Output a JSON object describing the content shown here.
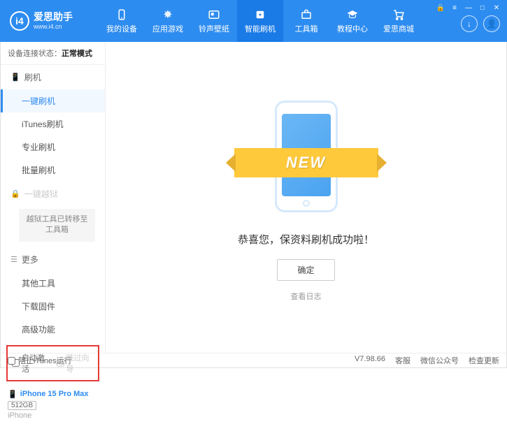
{
  "header": {
    "appName": "爱思助手",
    "appUrl": "www.i4.cn",
    "nav": [
      {
        "label": "我的设备"
      },
      {
        "label": "应用游戏"
      },
      {
        "label": "铃声壁纸"
      },
      {
        "label": "智能刷机"
      },
      {
        "label": "工具箱"
      },
      {
        "label": "教程中心"
      },
      {
        "label": "爱思商城"
      }
    ]
  },
  "sidebar": {
    "connLabel": "设备连接状态：",
    "connStatus": "正常模式",
    "secFlash": "刷机",
    "items1": [
      {
        "label": "一键刷机"
      },
      {
        "label": "iTunes刷机"
      },
      {
        "label": "专业刷机"
      },
      {
        "label": "批量刷机"
      }
    ],
    "secJailbreak": "一键越狱",
    "jailNote": "越狱工具已转移至工具箱",
    "secMore": "更多",
    "items2": [
      {
        "label": "其他工具"
      },
      {
        "label": "下载固件"
      },
      {
        "label": "高级功能"
      }
    ],
    "chkAuto": "自动激活",
    "chkSkip": "跳过向导",
    "deviceName": "iPhone 15 Pro Max",
    "deviceCap": "512GB",
    "deviceType": "iPhone"
  },
  "main": {
    "ribbon": "NEW",
    "success": "恭喜您，保资料刷机成功啦！",
    "ok": "确定",
    "viewlog": "查看日志"
  },
  "footer": {
    "blockItunes": "阻止iTunes运行",
    "version": "V7.98.66",
    "links": [
      "客服",
      "微信公众号",
      "检查更新"
    ]
  }
}
